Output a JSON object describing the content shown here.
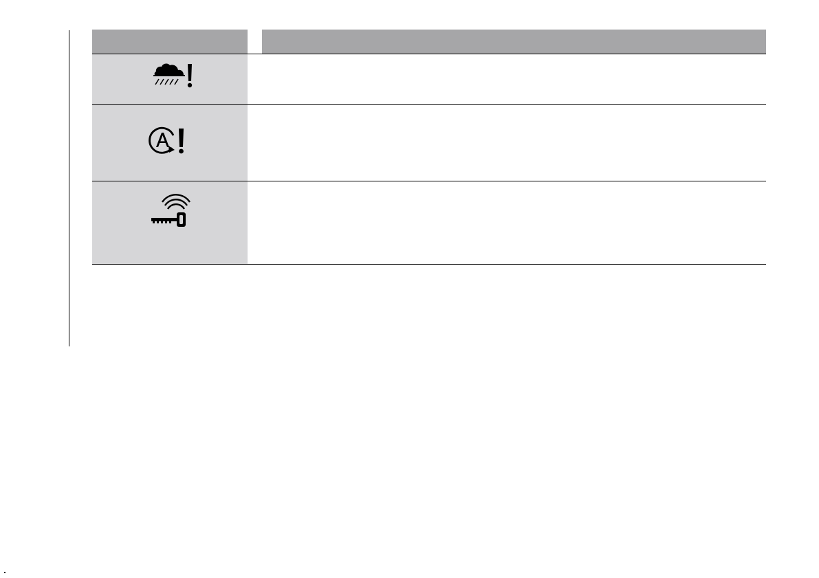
{
  "table": {
    "header": {
      "icon_column_label": "",
      "description_column_label": ""
    },
    "rows": [
      {
        "icon": "rain-sensor-warning-icon",
        "description": ""
      },
      {
        "icon": "auto-start-stop-warning-icon",
        "description": ""
      },
      {
        "icon": "keyless-key-signal-icon",
        "description": ""
      }
    ]
  },
  "colors": {
    "header_fill": "#a6a6a8",
    "icon_cell_fill": "#d6d6d8",
    "rule": "#000000"
  }
}
